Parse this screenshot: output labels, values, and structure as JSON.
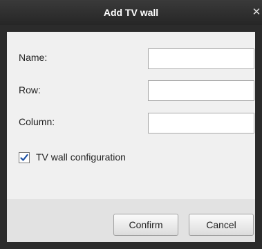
{
  "dialog": {
    "title": "Add TV wall",
    "close_symbol": "✕"
  },
  "form": {
    "name_label": "Name:",
    "name_value": "",
    "row_label": "Row:",
    "row_value": "",
    "column_label": "Column:",
    "column_value": "",
    "tvwall_config_label": "TV wall configuration",
    "tvwall_config_checked": true
  },
  "buttons": {
    "confirm_label": "Confirm",
    "cancel_label": "Cancel"
  },
  "icons": {
    "close": "close-icon",
    "check": "checkmark-icon"
  },
  "colors": {
    "titlebar": "#2b2b2b",
    "body": "#f0f0f0",
    "footer": "#e2e2e2",
    "check": "#1a4fa3"
  }
}
